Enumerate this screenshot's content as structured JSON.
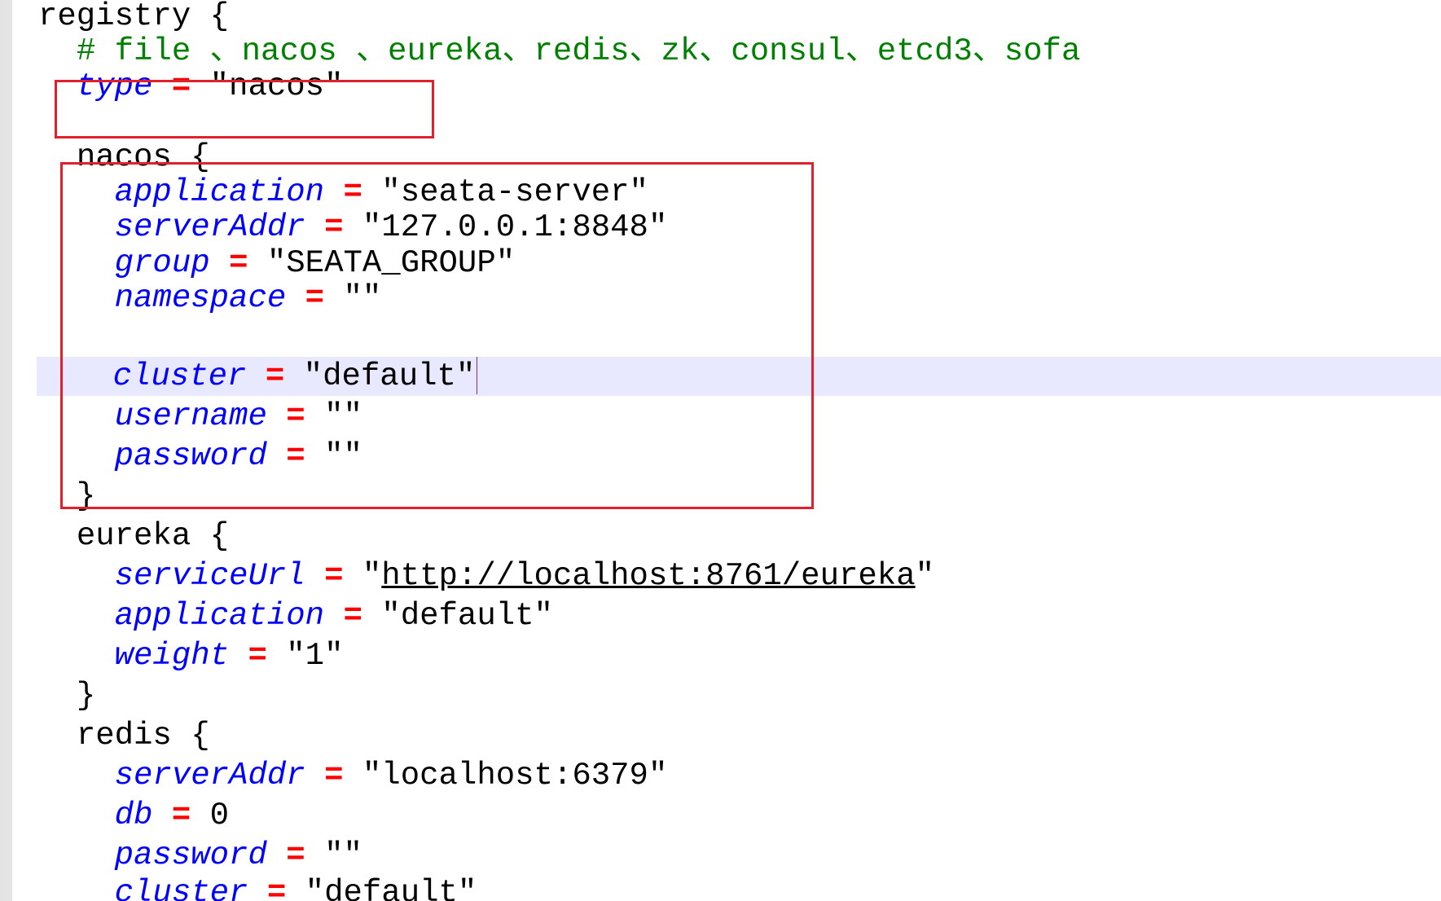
{
  "accent_colors": {
    "keyword": "#0000ff",
    "operator": "#ff0000",
    "comment": "#008000",
    "current_line": "#e8e8ff",
    "highlight_box": "#e0202a"
  },
  "code": {
    "line1": {
      "name": "registry",
      "brace": "{"
    },
    "line2": {
      "comment": "# file 、nacos 、eureka、redis、zk、consul、etcd3、sofa"
    },
    "line3": {
      "key": "type",
      "op": "=",
      "value": "\"nacos\""
    },
    "line5": {
      "name": "nacos",
      "brace": "{"
    },
    "line6": {
      "key": "application",
      "op": "=",
      "value": "\"seata-server\""
    },
    "line7": {
      "key": "serverAddr",
      "op": "=",
      "value": "\"127.0.0.1:8848\""
    },
    "line8": {
      "key": "group",
      "op": "=",
      "value": "\"SEATA_GROUP\""
    },
    "line9": {
      "key": "namespace",
      "op": "=",
      "value": "\"\""
    },
    "line10": {
      "key": "cluster",
      "op": "=",
      "value": "\"default\""
    },
    "line11": {
      "key": "username",
      "op": "=",
      "value": "\"\""
    },
    "line12": {
      "key": "password",
      "op": "=",
      "value": "\"\""
    },
    "line13": {
      "brace": "}"
    },
    "line14": {
      "name": "eureka",
      "brace": "{"
    },
    "line15": {
      "key": "serviceUrl",
      "op": "=",
      "quote_open": "\"",
      "url": "http://localhost:8761/eureka",
      "quote_close": "\""
    },
    "line16": {
      "key": "application",
      "op": "=",
      "value": "\"default\""
    },
    "line17": {
      "key": "weight",
      "op": "=",
      "value": "\"1\""
    },
    "line18": {
      "brace": "}"
    },
    "line19": {
      "name": "redis",
      "brace": "{"
    },
    "line20": {
      "key": "serverAddr",
      "op": "=",
      "value": "\"localhost:6379\""
    },
    "line21": {
      "key": "db",
      "op": "=",
      "value": "0"
    },
    "line22": {
      "key": "password",
      "op": "=",
      "value": "\"\""
    },
    "line23": {
      "key": "cluster",
      "op": "=",
      "value": "\"default\""
    }
  }
}
